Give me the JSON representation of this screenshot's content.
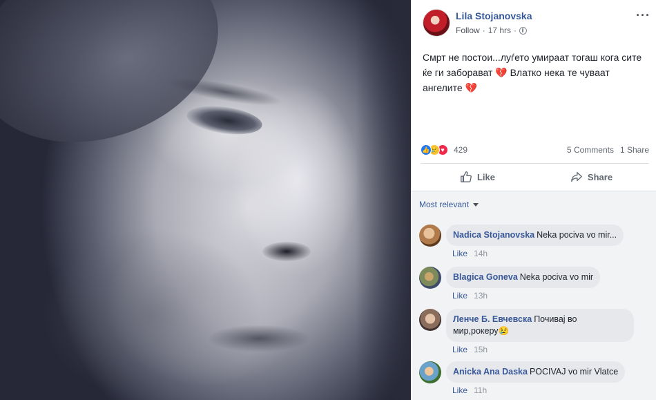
{
  "post": {
    "author": "Lila Stojanovska",
    "follow_label": "Follow",
    "time": "17 hrs",
    "separator": "·",
    "more_icon": "···",
    "text_line1": "Смрт не постои...луѓето умираат тогаш кога сите",
    "text_line2a": "ќе ги заборават ",
    "text_line2b": " Влатко нека те чуваат",
    "text_line3": "ангелите ",
    "emoji_broken_heart": "💔",
    "reaction_count": "429",
    "comments_count": "5 Comments",
    "shares_count": "1 Share",
    "like_label": "Like",
    "share_label": "Share"
  },
  "icons": {
    "reaction_like": "👍",
    "reaction_sad": "😢",
    "reaction_love": "♥"
  },
  "colors": {
    "link_blue": "#365899",
    "like_blue": "#2078f4",
    "love_red": "#f0284a",
    "sad_yellow": "#f7c437"
  },
  "comments": {
    "sort_label": "Most relevant",
    "items": [
      {
        "name": "Nadica Stojanovska",
        "text": "Neka pociva vo mir...",
        "like": "Like",
        "time": "14h"
      },
      {
        "name": "Blagica Goneva",
        "text": "Neka pociva vo mir",
        "like": "Like",
        "time": "13h"
      },
      {
        "name": "Ленче Б. Евчевска",
        "text_line1": "Почивај во",
        "text_line2": "мир,рокеру",
        "emoji": "😢",
        "like": "Like",
        "time": "15h"
      },
      {
        "name": "Anicka Ana Daska",
        "text": "POCIVAJ vo mir Vlatce",
        "like": "Like",
        "time": "11h"
      }
    ]
  }
}
